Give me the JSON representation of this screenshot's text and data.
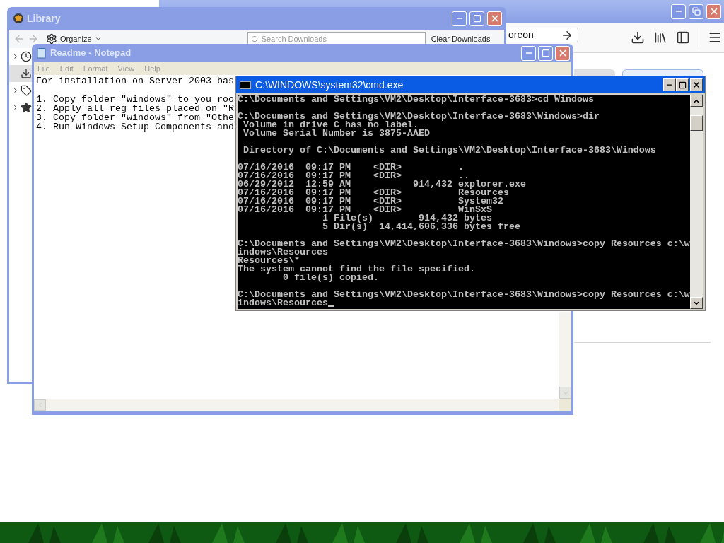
{
  "browser": {
    "url_text": "oreon"
  },
  "library": {
    "title": "Library",
    "organize": "Organize",
    "search_placeholder": "Search Downloads",
    "clear_button": "Clear Downloads",
    "sidebar": [
      {
        "kind": "history",
        "selected": false
      },
      {
        "kind": "downloads",
        "selected": true
      },
      {
        "kind": "tags",
        "selected": false
      },
      {
        "kind": "bookmarks",
        "selected": false
      }
    ]
  },
  "notepad": {
    "title": "Readme - Notepad",
    "menu": [
      "File",
      "Edit",
      "Format",
      "View",
      "Help"
    ],
    "blocks": [
      [
        "For installation on Server 2003 bas"
      ],
      [
        "1. Copy folder \"windows\" to you roo",
        "2. Apply all reg files placed on \"R",
        "3. Copy folder \"windows\" from \"Othe",
        "4. Run Windows Setup Components and"
      ]
    ]
  },
  "cmd": {
    "title": "C:\\WINDOWS\\system32\\cmd.exe",
    "blocks": [
      [
        "C:\\Documents and Settings\\VM2\\Desktop\\Interface-3683>cd Windows"
      ],
      [
        "C:\\Documents and Settings\\VM2\\Desktop\\Interface-3683\\Windows>dir",
        " Volume in drive C has no label.",
        " Volume Serial Number is 3875-AAED"
      ],
      [
        " Directory of C:\\Documents and Settings\\VM2\\Desktop\\Interface-3683\\Windows"
      ],
      [
        "07/16/2016  09:17 PM    <DIR>          .",
        "07/16/2016  09:17 PM    <DIR>          ..",
        "06/29/2012  12:59 AM           914,432 explorer.exe",
        "07/16/2016  09:17 PM    <DIR>          Resources",
        "07/16/2016  09:17 PM    <DIR>          System32",
        "07/16/2016  09:17 PM    <DIR>          WinSxS",
        "               1 File(s)        914,432 bytes",
        "               5 Dir(s)  14,414,606,336 bytes free"
      ],
      [
        "C:\\Documents and Settings\\VM2\\Desktop\\Interface-3683\\Windows>copy Resources c:\\w",
        "indows\\Resources",
        "Resources\\*",
        "The system cannot find the file specified.",
        "        0 file(s) copied."
      ],
      [
        "C:\\Documents and Settings\\VM2\\Desktop\\Interface-3683\\Windows>copy Resources c:\\w",
        "indows\\Resources"
      ]
    ]
  }
}
